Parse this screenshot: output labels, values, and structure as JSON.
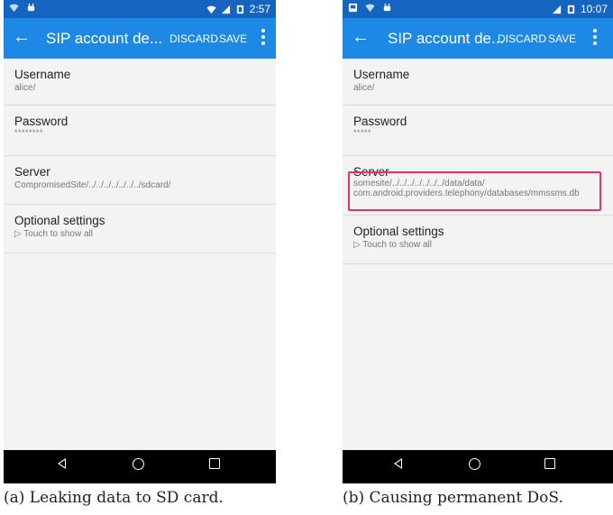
{
  "panels": [
    {
      "status_time": "2:57",
      "toolbar": {
        "title": "SIP account de...",
        "discard": "DISCARD",
        "save": "SAVE"
      },
      "username": {
        "label": "Username",
        "value": "alice/"
      },
      "password": {
        "label": "Password",
        "value": "********"
      },
      "server": {
        "label": "Server",
        "value_lines": [
          "CompromisedSite/../../../../../../../sdcard/"
        ]
      },
      "optional": {
        "label": "Optional settings",
        "hint": "▷ Touch to show all"
      },
      "caption": "(a) Leaking data to SD card."
    },
    {
      "status_time": "10:07",
      "toolbar": {
        "title": "SIP account de...",
        "discard": "DISCARD",
        "save": "SAVE"
      },
      "username": {
        "label": "Username",
        "value": "alice/"
      },
      "password": {
        "label": "Password",
        "value": "*****"
      },
      "server": {
        "label": "Server",
        "value_lines": [
          "somesite/../../../../../../../data/data/",
          "com.android.providers.telephony/databases/mmssms.db"
        ]
      },
      "optional": {
        "label": "Optional settings",
        "hint": "▷ Touch to show all"
      },
      "caption": "(b) Causing permanent DoS."
    }
  ],
  "colors": {
    "status_bar": "#1565c0",
    "toolbar": "#1e88e5",
    "highlight": "#e0336e"
  },
  "icons": [
    "wifi-icon",
    "robot-icon",
    "signal-icon",
    "battery-icon",
    "sim-icon",
    "back-arrow-icon",
    "more-vert-icon",
    "nav-back-icon",
    "nav-home-icon",
    "nav-recents-icon"
  ]
}
